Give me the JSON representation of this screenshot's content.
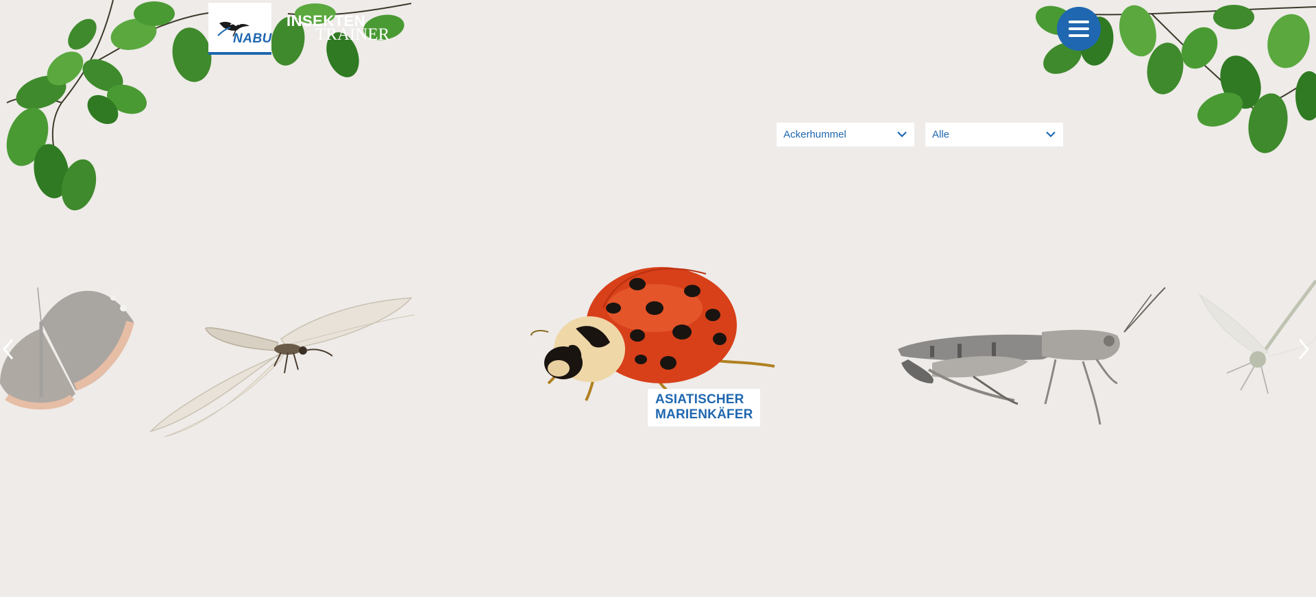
{
  "brand": {
    "logo_text": "NABU",
    "title_line1": "INSEKTEN",
    "title_line2": "TRAINER"
  },
  "header": {
    "menu_icon": "hamburger-menu-icon"
  },
  "filters": {
    "species": {
      "selected": "Ackerhummel"
    },
    "category": {
      "selected": "Alle"
    }
  },
  "carousel": {
    "featured": {
      "name_line1": "ASIATISCHER",
      "name_line2": "MARIENKÄFER"
    },
    "prev_icon": "chevron-left-icon",
    "next_icon": "chevron-right-icon"
  },
  "colors": {
    "background": "#eeebe8",
    "accent": "#1f67b0",
    "leaf": "#3f8a2c"
  }
}
